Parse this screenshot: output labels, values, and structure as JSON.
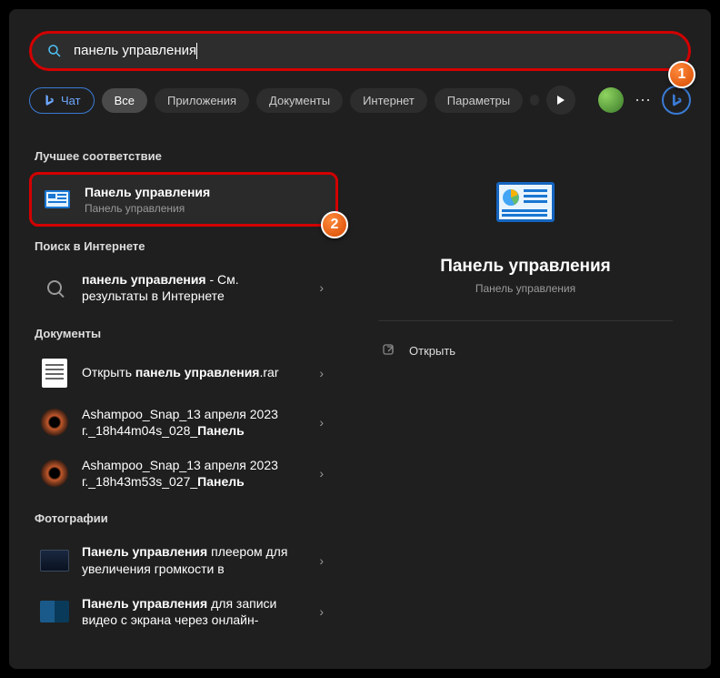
{
  "search": {
    "query": "панель управления"
  },
  "tabs": {
    "chat": "Чат",
    "all": "Все",
    "apps": "Приложения",
    "docs": "Документы",
    "web": "Интернет",
    "params": "Параметры"
  },
  "callouts": {
    "one": "1",
    "two": "2"
  },
  "sections": {
    "best": "Лучшее соответствие",
    "web": "Поиск в Интернете",
    "docs": "Документы",
    "photos": "Фотографии"
  },
  "best": {
    "title": "Панель управления",
    "sub": "Панель управления"
  },
  "webres": {
    "bold": "панель управления",
    "rest": " - См. результаты в Интернете"
  },
  "doc1": {
    "pre": "Открыть ",
    "bold": "панель управления",
    "post": ".rar"
  },
  "doc2": {
    "line1": "Ashampoo_Snap_13 апреля 2023",
    "line2_a": "г._18h44m04s_028_",
    "line2_b": "Панель"
  },
  "doc3": {
    "line1": "Ashampoo_Snap_13 апреля 2023",
    "line2_a": "г._18h43m53s_027_",
    "line2_b": "Панель"
  },
  "photo1": {
    "bold": "Панель управления",
    "rest": " плеером для увеличения громкости в"
  },
  "photo2": {
    "bold": "Панель управления",
    "rest": " для записи видео с экрана через онлайн-"
  },
  "preview": {
    "title": "Панель управления",
    "sub": "Панель управления",
    "open": "Открыть"
  }
}
